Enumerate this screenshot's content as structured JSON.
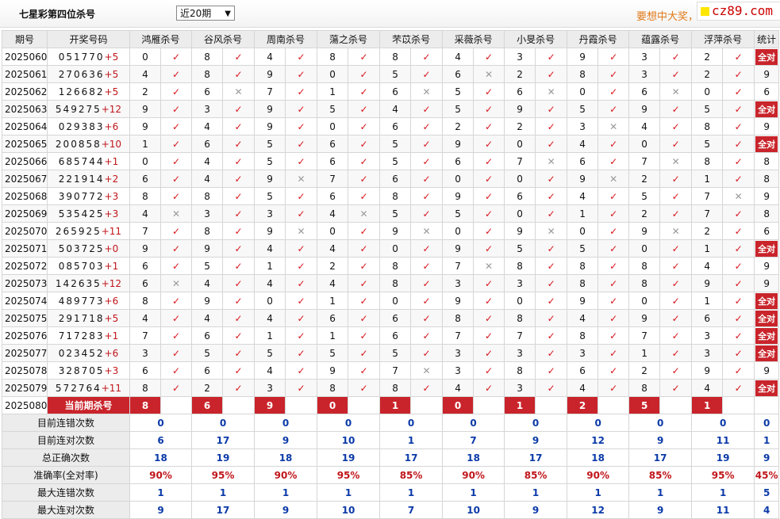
{
  "header": {
    "title": "七星彩第四位杀号",
    "period_select": "近20期",
    "slogan": "要想中大奖，",
    "logo_text": "cz89.com"
  },
  "columns": {
    "issue": "期号",
    "draw": "开奖号码",
    "experts": [
      "鸿雁杀号",
      "谷风杀号",
      "周南杀号",
      "蕩之杀号",
      "芣苡杀号",
      "采薇杀号",
      "小旻杀号",
      "丹霞杀号",
      "蕴露杀号",
      "浮萍杀号"
    ],
    "stat": "统计"
  },
  "rows": [
    {
      "issue": "2025060",
      "digits": "051770",
      "tail": "+5",
      "kills": [
        [
          "0",
          1
        ],
        [
          "8",
          1
        ],
        [
          "4",
          1
        ],
        [
          "8",
          1
        ],
        [
          "8",
          1
        ],
        [
          "4",
          1
        ],
        [
          "3",
          1
        ],
        [
          "9",
          1
        ],
        [
          "3",
          1
        ],
        [
          "2",
          1
        ]
      ],
      "stat": "全对"
    },
    {
      "issue": "2025061",
      "digits": "270636",
      "tail": "+5",
      "kills": [
        [
          "4",
          1
        ],
        [
          "8",
          1
        ],
        [
          "9",
          1
        ],
        [
          "0",
          1
        ],
        [
          "5",
          1
        ],
        [
          "6",
          0
        ],
        [
          "2",
          1
        ],
        [
          "8",
          1
        ],
        [
          "3",
          1
        ],
        [
          "2",
          1
        ]
      ],
      "stat": "9"
    },
    {
      "issue": "2025062",
      "digits": "126682",
      "tail": "+5",
      "kills": [
        [
          "2",
          1
        ],
        [
          "6",
          0
        ],
        [
          "7",
          1
        ],
        [
          "1",
          1
        ],
        [
          "6",
          0
        ],
        [
          "5",
          1
        ],
        [
          "6",
          0
        ],
        [
          "0",
          1
        ],
        [
          "6",
          0
        ],
        [
          "0",
          1
        ]
      ],
      "stat": "6"
    },
    {
      "issue": "2025063",
      "digits": "549275",
      "tail": "+12",
      "kills": [
        [
          "9",
          1
        ],
        [
          "3",
          1
        ],
        [
          "9",
          1
        ],
        [
          "5",
          1
        ],
        [
          "4",
          1
        ],
        [
          "5",
          1
        ],
        [
          "9",
          1
        ],
        [
          "5",
          1
        ],
        [
          "9",
          1
        ],
        [
          "5",
          1
        ]
      ],
      "stat": "全对"
    },
    {
      "issue": "2025064",
      "digits": "029383",
      "tail": "+6",
      "kills": [
        [
          "9",
          1
        ],
        [
          "4",
          1
        ],
        [
          "9",
          1
        ],
        [
          "0",
          1
        ],
        [
          "6",
          1
        ],
        [
          "2",
          1
        ],
        [
          "2",
          1
        ],
        [
          "3",
          0
        ],
        [
          "4",
          1
        ],
        [
          "8",
          1
        ]
      ],
      "stat": "9"
    },
    {
      "issue": "2025065",
      "digits": "200858",
      "tail": "+10",
      "kills": [
        [
          "1",
          1
        ],
        [
          "6",
          1
        ],
        [
          "5",
          1
        ],
        [
          "6",
          1
        ],
        [
          "5",
          1
        ],
        [
          "9",
          1
        ],
        [
          "0",
          1
        ],
        [
          "4",
          1
        ],
        [
          "0",
          1
        ],
        [
          "5",
          1
        ]
      ],
      "stat": "全对"
    },
    {
      "issue": "2025066",
      "digits": "685744",
      "tail": "+1",
      "kills": [
        [
          "0",
          1
        ],
        [
          "4",
          1
        ],
        [
          "5",
          1
        ],
        [
          "6",
          1
        ],
        [
          "5",
          1
        ],
        [
          "6",
          1
        ],
        [
          "7",
          0
        ],
        [
          "6",
          1
        ],
        [
          "7",
          0
        ],
        [
          "8",
          1
        ]
      ],
      "stat": "8"
    },
    {
      "issue": "2025067",
      "digits": "221914",
      "tail": "+2",
      "kills": [
        [
          "6",
          1
        ],
        [
          "4",
          1
        ],
        [
          "9",
          0
        ],
        [
          "7",
          1
        ],
        [
          "6",
          1
        ],
        [
          "0",
          1
        ],
        [
          "0",
          1
        ],
        [
          "9",
          0
        ],
        [
          "2",
          1
        ],
        [
          "1",
          1
        ]
      ],
      "stat": "8"
    },
    {
      "issue": "2025068",
      "digits": "390772",
      "tail": "+3",
      "kills": [
        [
          "8",
          1
        ],
        [
          "8",
          1
        ],
        [
          "5",
          1
        ],
        [
          "6",
          1
        ],
        [
          "8",
          1
        ],
        [
          "9",
          1
        ],
        [
          "6",
          1
        ],
        [
          "4",
          1
        ],
        [
          "5",
          1
        ],
        [
          "7",
          0
        ]
      ],
      "stat": "9"
    },
    {
      "issue": "2025069",
      "digits": "535425",
      "tail": "+3",
      "kills": [
        [
          "4",
          0
        ],
        [
          "3",
          1
        ],
        [
          "3",
          1
        ],
        [
          "4",
          0
        ],
        [
          "5",
          1
        ],
        [
          "5",
          1
        ],
        [
          "0",
          1
        ],
        [
          "1",
          1
        ],
        [
          "2",
          1
        ],
        [
          "7",
          1
        ]
      ],
      "stat": "8"
    },
    {
      "issue": "2025070",
      "digits": "265925",
      "tail": "+11",
      "kills": [
        [
          "7",
          1
        ],
        [
          "8",
          1
        ],
        [
          "9",
          0
        ],
        [
          "0",
          1
        ],
        [
          "9",
          0
        ],
        [
          "0",
          1
        ],
        [
          "9",
          0
        ],
        [
          "0",
          1
        ],
        [
          "9",
          0
        ],
        [
          "2",
          1
        ]
      ],
      "stat": "6"
    },
    {
      "issue": "2025071",
      "digits": "503725",
      "tail": "+0",
      "kills": [
        [
          "9",
          1
        ],
        [
          "9",
          1
        ],
        [
          "4",
          1
        ],
        [
          "4",
          1
        ],
        [
          "0",
          1
        ],
        [
          "9",
          1
        ],
        [
          "5",
          1
        ],
        [
          "5",
          1
        ],
        [
          "0",
          1
        ],
        [
          "1",
          1
        ]
      ],
      "stat": "全对"
    },
    {
      "issue": "2025072",
      "digits": "085703",
      "tail": "+1",
      "kills": [
        [
          "6",
          1
        ],
        [
          "5",
          1
        ],
        [
          "1",
          1
        ],
        [
          "2",
          1
        ],
        [
          "8",
          1
        ],
        [
          "7",
          0
        ],
        [
          "8",
          1
        ],
        [
          "8",
          1
        ],
        [
          "8",
          1
        ],
        [
          "4",
          1
        ]
      ],
      "stat": "9"
    },
    {
      "issue": "2025073",
      "digits": "142635",
      "tail": "+12",
      "kills": [
        [
          "6",
          0
        ],
        [
          "4",
          1
        ],
        [
          "4",
          1
        ],
        [
          "4",
          1
        ],
        [
          "8",
          1
        ],
        [
          "3",
          1
        ],
        [
          "3",
          1
        ],
        [
          "8",
          1
        ],
        [
          "8",
          1
        ],
        [
          "9",
          1
        ]
      ],
      "stat": "9"
    },
    {
      "issue": "2025074",
      "digits": "489773",
      "tail": "+6",
      "kills": [
        [
          "8",
          1
        ],
        [
          "9",
          1
        ],
        [
          "0",
          1
        ],
        [
          "1",
          1
        ],
        [
          "0",
          1
        ],
        [
          "9",
          1
        ],
        [
          "0",
          1
        ],
        [
          "9",
          1
        ],
        [
          "0",
          1
        ],
        [
          "1",
          1
        ]
      ],
      "stat": "全对"
    },
    {
      "issue": "2025075",
      "digits": "291718",
      "tail": "+5",
      "kills": [
        [
          "4",
          1
        ],
        [
          "4",
          1
        ],
        [
          "4",
          1
        ],
        [
          "6",
          1
        ],
        [
          "6",
          1
        ],
        [
          "8",
          1
        ],
        [
          "8",
          1
        ],
        [
          "4",
          1
        ],
        [
          "9",
          1
        ],
        [
          "6",
          1
        ]
      ],
      "stat": "全对"
    },
    {
      "issue": "2025076",
      "digits": "717283",
      "tail": "+1",
      "kills": [
        [
          "7",
          1
        ],
        [
          "6",
          1
        ],
        [
          "1",
          1
        ],
        [
          "1",
          1
        ],
        [
          "6",
          1
        ],
        [
          "7",
          1
        ],
        [
          "7",
          1
        ],
        [
          "8",
          1
        ],
        [
          "7",
          1
        ],
        [
          "3",
          1
        ]
      ],
      "stat": "全对"
    },
    {
      "issue": "2025077",
      "digits": "023452",
      "tail": "+6",
      "kills": [
        [
          "3",
          1
        ],
        [
          "5",
          1
        ],
        [
          "5",
          1
        ],
        [
          "5",
          1
        ],
        [
          "5",
          1
        ],
        [
          "3",
          1
        ],
        [
          "3",
          1
        ],
        [
          "3",
          1
        ],
        [
          "1",
          1
        ],
        [
          "3",
          1
        ]
      ],
      "stat": "全对"
    },
    {
      "issue": "2025078",
      "digits": "328705",
      "tail": "+3",
      "kills": [
        [
          "6",
          1
        ],
        [
          "6",
          1
        ],
        [
          "4",
          1
        ],
        [
          "9",
          1
        ],
        [
          "7",
          0
        ],
        [
          "3",
          1
        ],
        [
          "8",
          1
        ],
        [
          "6",
          1
        ],
        [
          "2",
          1
        ],
        [
          "9",
          1
        ]
      ],
      "stat": "9"
    },
    {
      "issue": "2025079",
      "digits": "572764",
      "tail": "+11",
      "kills": [
        [
          "8",
          1
        ],
        [
          "2",
          1
        ],
        [
          "3",
          1
        ],
        [
          "8",
          1
        ],
        [
          "8",
          1
        ],
        [
          "4",
          1
        ],
        [
          "3",
          1
        ],
        [
          "4",
          1
        ],
        [
          "8",
          1
        ],
        [
          "4",
          1
        ]
      ],
      "stat": "全对"
    }
  ],
  "current": {
    "issue": "2025080",
    "label": "当前期杀号",
    "kills": [
      "8",
      "6",
      "9",
      "0",
      "1",
      "0",
      "1",
      "2",
      "5",
      "1"
    ]
  },
  "stats": [
    {
      "label": "目前连错次数",
      "values": [
        "0",
        "0",
        "0",
        "0",
        "0",
        "0",
        "0",
        "0",
        "0",
        "0"
      ],
      "total": "0",
      "style": "blue"
    },
    {
      "label": "目前连对次数",
      "values": [
        "6",
        "17",
        "9",
        "10",
        "1",
        "7",
        "9",
        "12",
        "9",
        "11"
      ],
      "total": "1",
      "style": "blue"
    },
    {
      "label": "总正确次数",
      "values": [
        "18",
        "19",
        "18",
        "19",
        "17",
        "18",
        "17",
        "18",
        "17",
        "19"
      ],
      "total": "9",
      "style": "blue"
    },
    {
      "label": "准确率(全对率)",
      "values": [
        "90%",
        "95%",
        "90%",
        "95%",
        "85%",
        "90%",
        "85%",
        "90%",
        "85%",
        "95%"
      ],
      "total": "45%",
      "style": "red"
    },
    {
      "label": "最大连错次数",
      "values": [
        "1",
        "1",
        "1",
        "1",
        "1",
        "1",
        "1",
        "1",
        "1",
        "1"
      ],
      "total": "5",
      "style": "blue"
    },
    {
      "label": "最大连对次数",
      "values": [
        "9",
        "17",
        "9",
        "10",
        "7",
        "10",
        "9",
        "12",
        "9",
        "11"
      ],
      "total": "4",
      "style": "blue"
    }
  ],
  "marks": {
    "right": "✓",
    "wrong": "✕"
  },
  "colors": {
    "accent": "#c9242b",
    "stat_blue": "#0b3aa8",
    "slogan": "#e07a1a"
  }
}
